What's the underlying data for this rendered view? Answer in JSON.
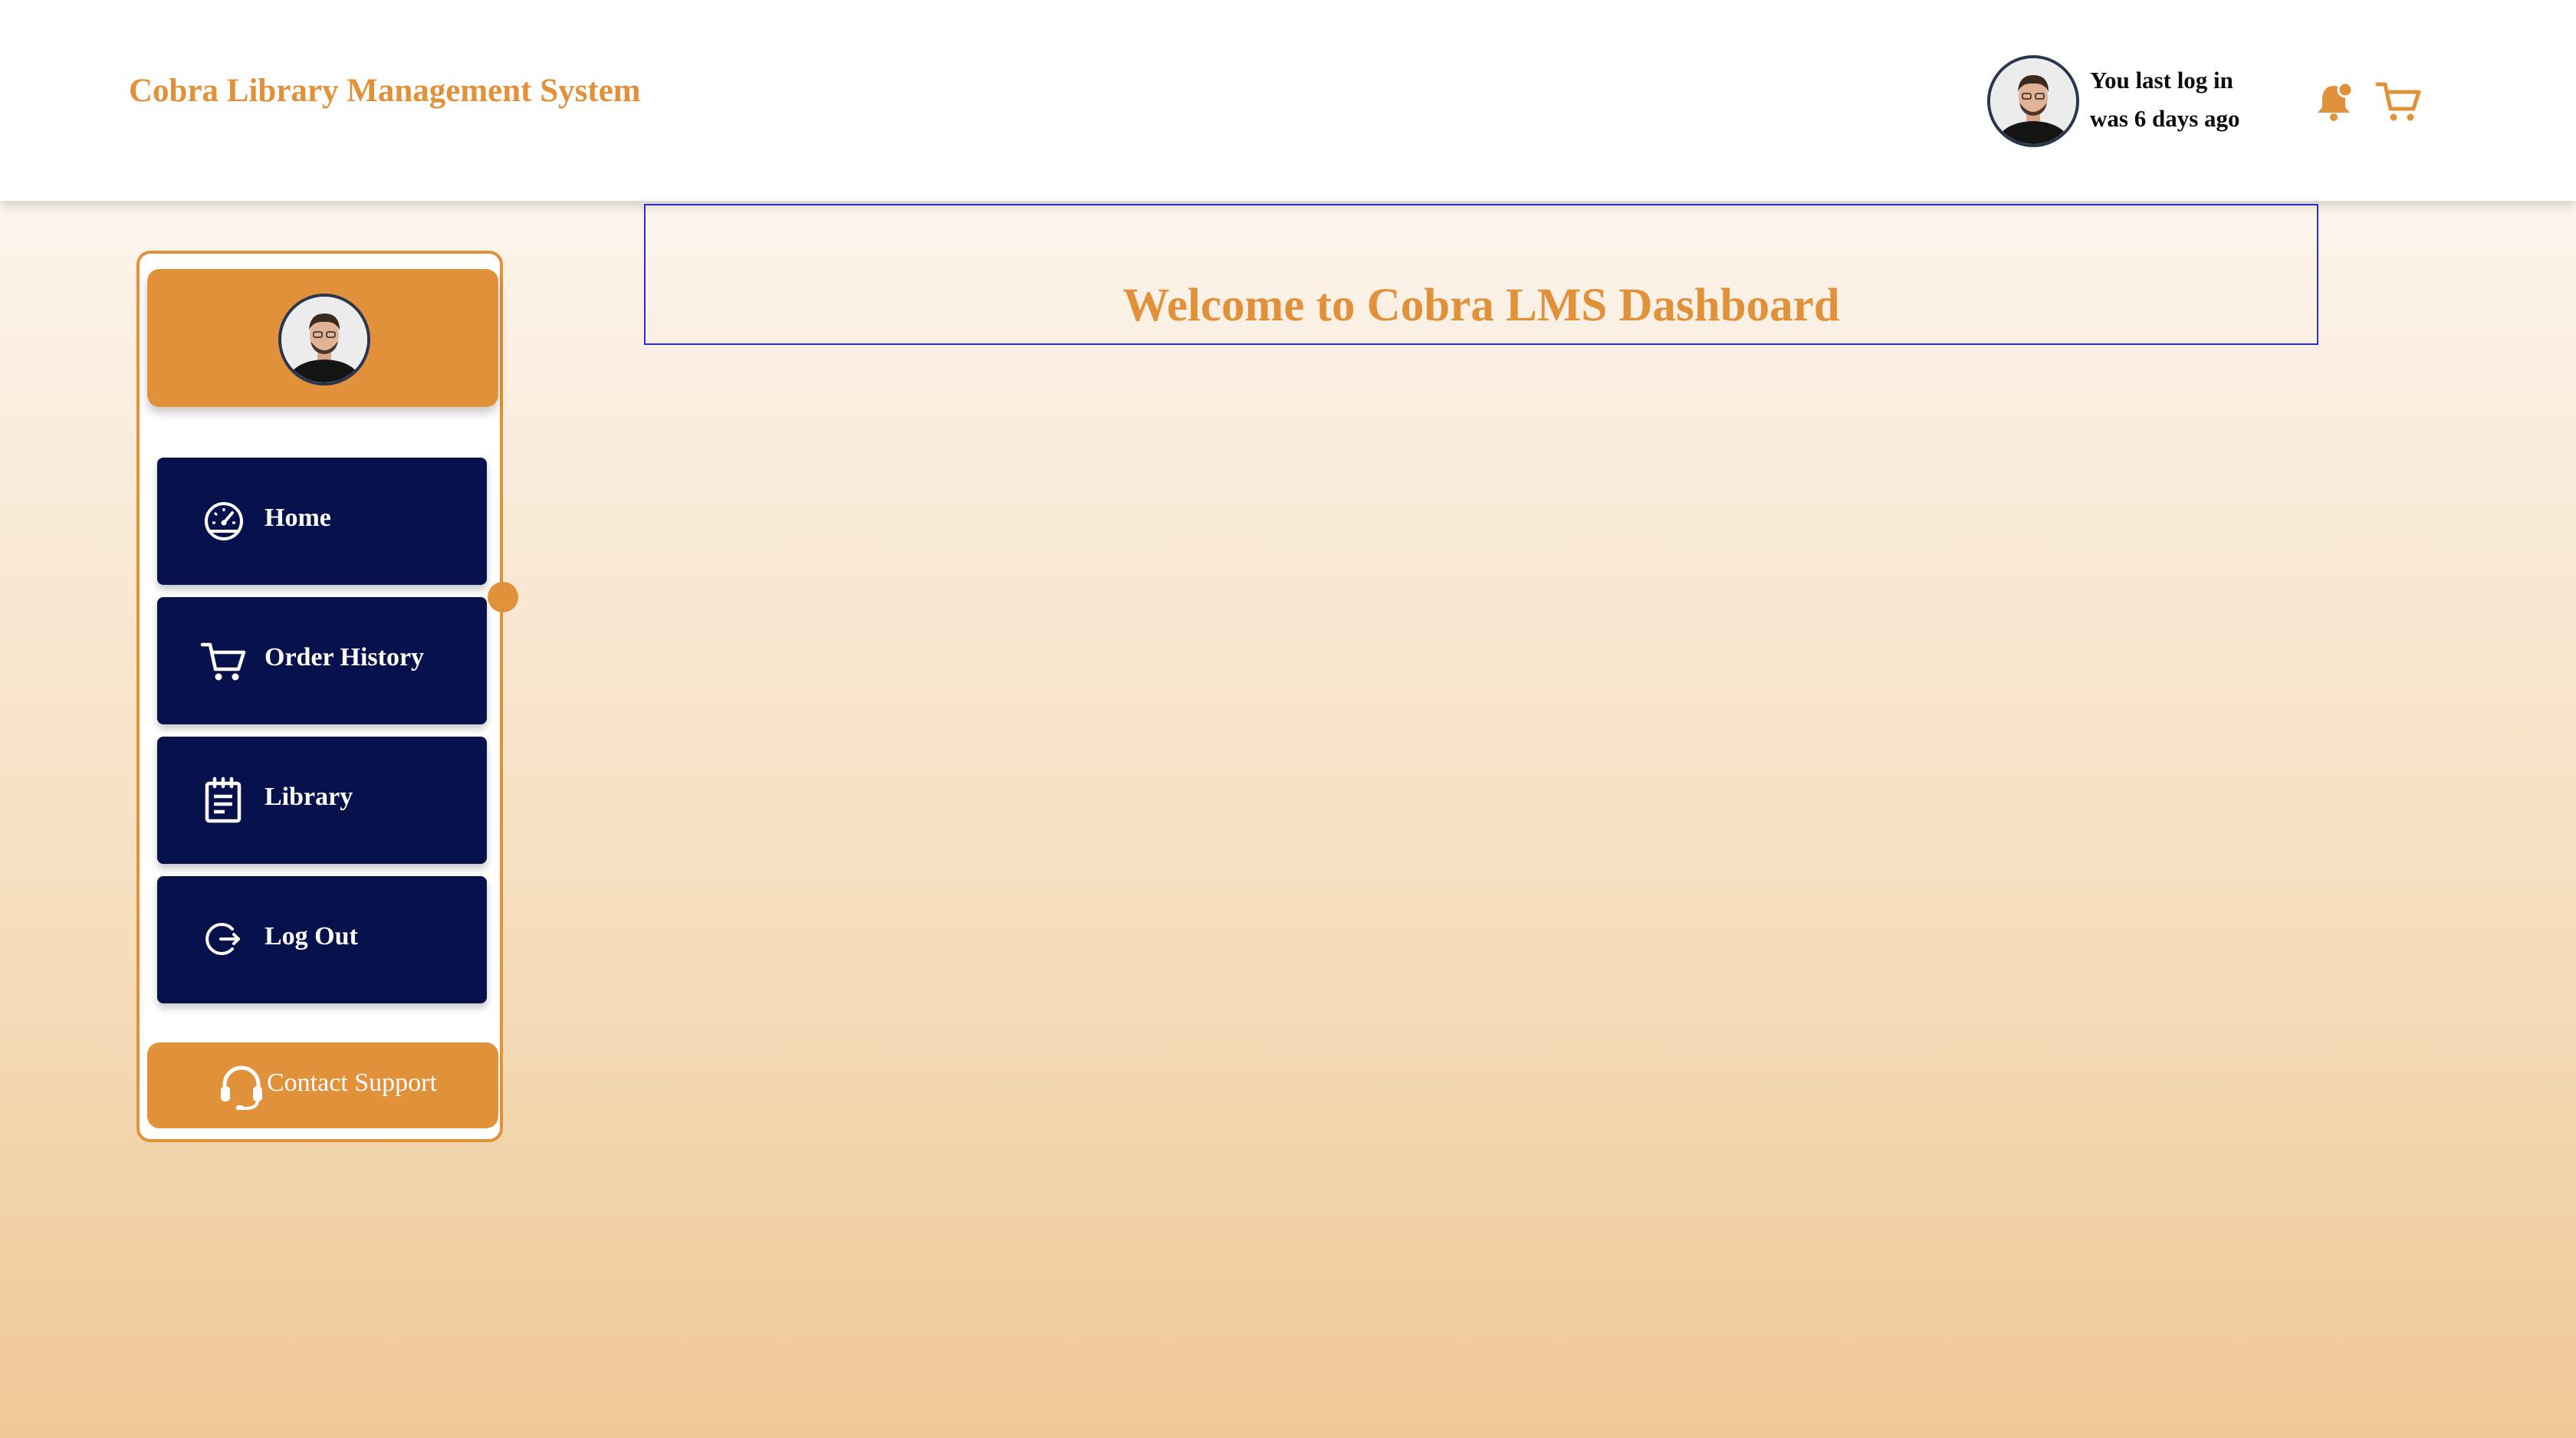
{
  "header": {
    "app_title": "Cobra Library Management System",
    "last_login_line1": "You last log in",
    "last_login_line2": "was 6 days ago",
    "icons": [
      "avatar",
      "bell-icon",
      "cart-icon"
    ]
  },
  "sidebar": {
    "profile_icon": "avatar",
    "items": [
      {
        "label": "Home",
        "icon": "dashboard-gauge-icon"
      },
      {
        "label": "Order History",
        "icon": "cart-icon"
      },
      {
        "label": "Library",
        "icon": "clipboard-list-icon"
      },
      {
        "label": "Log Out",
        "icon": "logout-icon"
      }
    ],
    "support_label": "Contact Support",
    "support_icon": "headset-icon"
  },
  "main": {
    "welcome_title": "Welcome to Cobra LMS Dashboard"
  },
  "colors": {
    "accent": "#e1913a",
    "nav_bg": "#07124d",
    "welcome_border": "#2c2cd6"
  }
}
